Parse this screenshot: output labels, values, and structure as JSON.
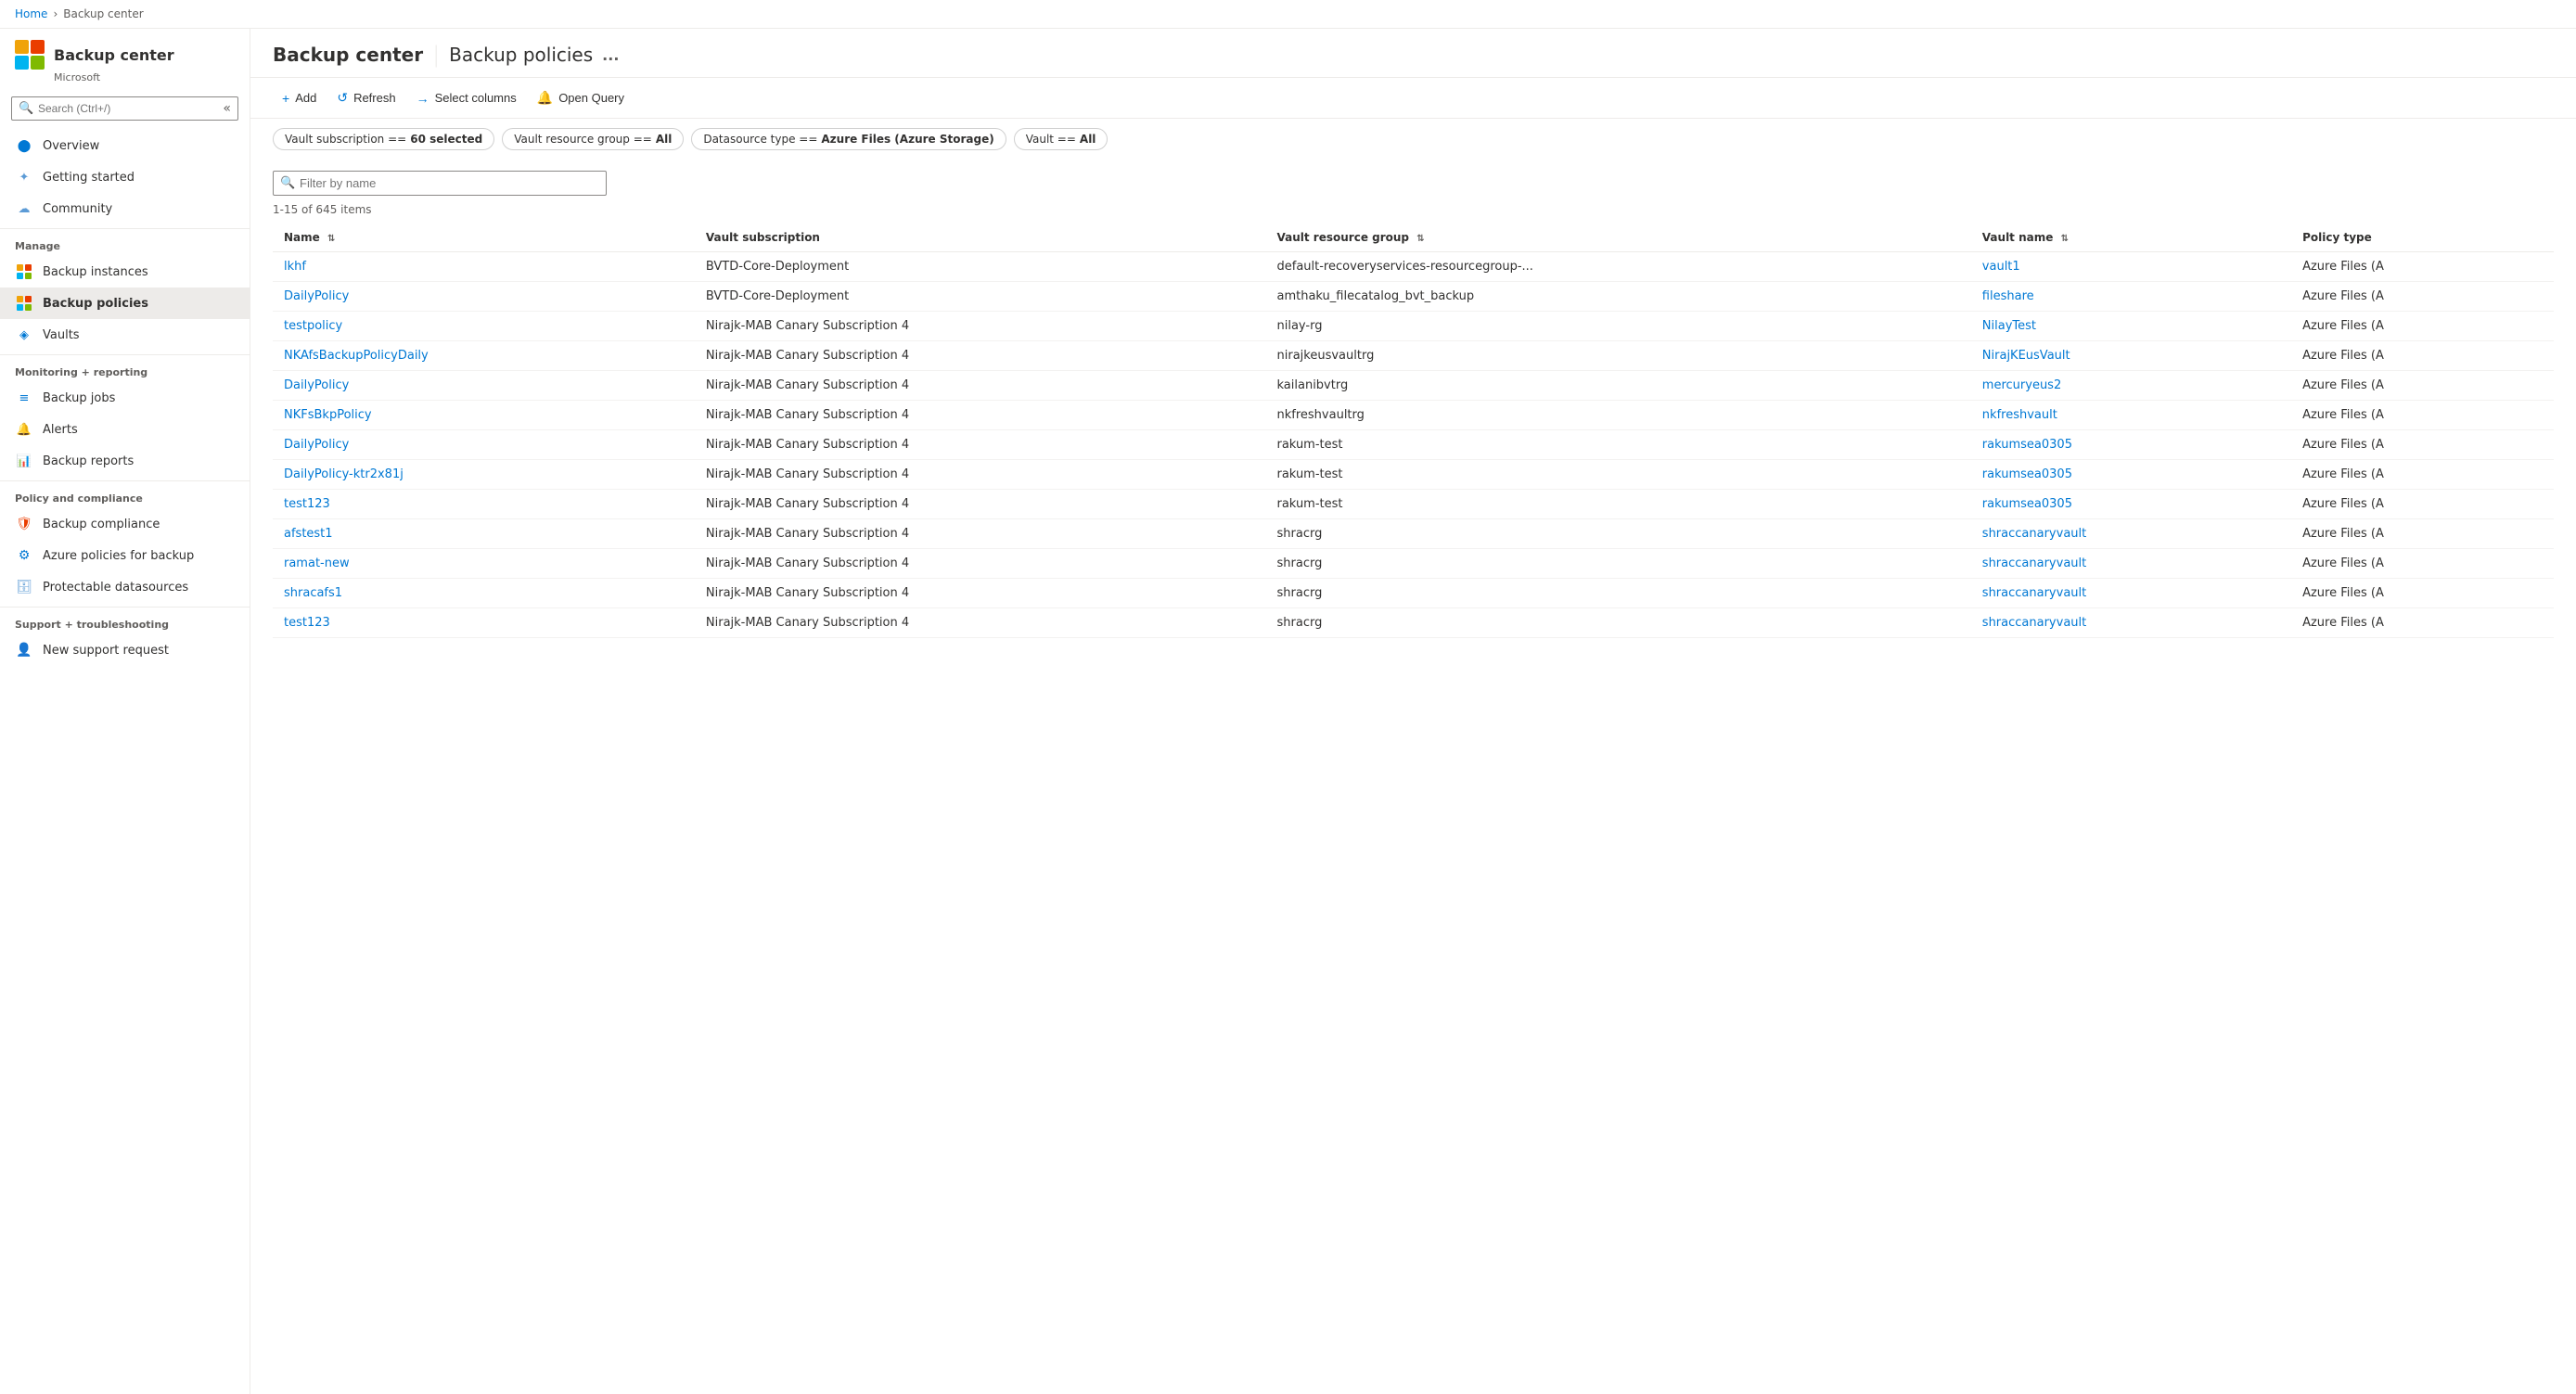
{
  "breadcrumb": {
    "home": "Home",
    "current": "Backup center"
  },
  "sidebar": {
    "logo_alt": "Backup center logo",
    "title": "Backup center",
    "subtitle": "Microsoft",
    "search_placeholder": "Search (Ctrl+/)",
    "collapse_title": "Collapse",
    "nav_items": [
      {
        "id": "overview",
        "label": "Overview",
        "icon": "circle"
      },
      {
        "id": "getting-started",
        "label": "Getting started",
        "icon": "spark"
      },
      {
        "id": "community",
        "label": "Community",
        "icon": "people"
      }
    ],
    "sections": [
      {
        "title": "Manage",
        "items": [
          {
            "id": "backup-instances",
            "label": "Backup instances",
            "icon": "grid"
          },
          {
            "id": "backup-policies",
            "label": "Backup policies",
            "icon": "grid-yellow",
            "active": true
          },
          {
            "id": "vaults",
            "label": "Vaults",
            "icon": "cube"
          }
        ]
      },
      {
        "title": "Monitoring + reporting",
        "items": [
          {
            "id": "backup-jobs",
            "label": "Backup jobs",
            "icon": "list"
          },
          {
            "id": "alerts",
            "label": "Alerts",
            "icon": "bell-green"
          },
          {
            "id": "backup-reports",
            "label": "Backup reports",
            "icon": "chart"
          }
        ]
      },
      {
        "title": "Policy and compliance",
        "items": [
          {
            "id": "backup-compliance",
            "label": "Backup compliance",
            "icon": "shield-orange"
          },
          {
            "id": "azure-policies",
            "label": "Azure policies for backup",
            "icon": "gear-blue"
          },
          {
            "id": "protectable-datasources",
            "label": "Protectable datasources",
            "icon": "db-blue"
          }
        ]
      },
      {
        "title": "Support + troubleshooting",
        "items": [
          {
            "id": "new-support",
            "label": "New support request",
            "icon": "person"
          }
        ]
      }
    ]
  },
  "header": {
    "title": "Backup center",
    "separator": "|",
    "page": "Backup policies",
    "more_label": "..."
  },
  "toolbar": {
    "add_label": "Add",
    "refresh_label": "Refresh",
    "select_columns_label": "Select columns",
    "open_query_label": "Open Query"
  },
  "filters": [
    {
      "key": "Vault subscription",
      "op": "==",
      "value": "60 selected"
    },
    {
      "key": "Vault resource group",
      "op": "==",
      "value": "All"
    },
    {
      "key": "Datasource type",
      "op": "==",
      "value": "Azure Files (Azure Storage)"
    },
    {
      "key": "Vault",
      "op": "==",
      "value": "All"
    }
  ],
  "filter_input": {
    "placeholder": "Filter by name"
  },
  "items_count": "1-15 of 645 items",
  "table": {
    "columns": [
      {
        "id": "name",
        "label": "Name",
        "sortable": true
      },
      {
        "id": "vault_subscription",
        "label": "Vault subscription",
        "sortable": false
      },
      {
        "id": "vault_resource_group",
        "label": "Vault resource group",
        "sortable": true
      },
      {
        "id": "vault_name",
        "label": "Vault name",
        "sortable": true
      },
      {
        "id": "policy_type",
        "label": "Policy type",
        "sortable": false
      }
    ],
    "rows": [
      {
        "name": "lkhf",
        "vault_subscription": "BVTD-Core-Deployment",
        "vault_resource_group": "default-recoveryservices-resourcegroup-...",
        "vault_name": "vault1",
        "policy_type": "Azure Files (A"
      },
      {
        "name": "DailyPolicy",
        "vault_subscription": "BVTD-Core-Deployment",
        "vault_resource_group": "amthaku_filecatalog_bvt_backup",
        "vault_name": "fileshare",
        "policy_type": "Azure Files (A"
      },
      {
        "name": "testpolicy",
        "vault_subscription": "Nirajk-MAB Canary Subscription 4",
        "vault_resource_group": "nilay-rg",
        "vault_name": "NilayTest",
        "policy_type": "Azure Files (A"
      },
      {
        "name": "NKAfsBackupPolicyDaily",
        "vault_subscription": "Nirajk-MAB Canary Subscription 4",
        "vault_resource_group": "nirajkeusvaultrg",
        "vault_name": "NirajKEusVault",
        "policy_type": "Azure Files (A"
      },
      {
        "name": "DailyPolicy",
        "vault_subscription": "Nirajk-MAB Canary Subscription 4",
        "vault_resource_group": "kailanibvtrg",
        "vault_name": "mercuryeus2",
        "policy_type": "Azure Files (A"
      },
      {
        "name": "NKFsBkpPolicy",
        "vault_subscription": "Nirajk-MAB Canary Subscription 4",
        "vault_resource_group": "nkfreshvaultrg",
        "vault_name": "nkfreshvault",
        "policy_type": "Azure Files (A"
      },
      {
        "name": "DailyPolicy",
        "vault_subscription": "Nirajk-MAB Canary Subscription 4",
        "vault_resource_group": "rakum-test",
        "vault_name": "rakumsea0305",
        "policy_type": "Azure Files (A"
      },
      {
        "name": "DailyPolicy-ktr2x81j",
        "vault_subscription": "Nirajk-MAB Canary Subscription 4",
        "vault_resource_group": "rakum-test",
        "vault_name": "rakumsea0305",
        "policy_type": "Azure Files (A"
      },
      {
        "name": "test123",
        "vault_subscription": "Nirajk-MAB Canary Subscription 4",
        "vault_resource_group": "rakum-test",
        "vault_name": "rakumsea0305",
        "policy_type": "Azure Files (A"
      },
      {
        "name": "afstest1",
        "vault_subscription": "Nirajk-MAB Canary Subscription 4",
        "vault_resource_group": "shracrg",
        "vault_name": "shraccanaryvault",
        "policy_type": "Azure Files (A"
      },
      {
        "name": "ramat-new",
        "vault_subscription": "Nirajk-MAB Canary Subscription 4",
        "vault_resource_group": "shracrg",
        "vault_name": "shraccanaryvault",
        "policy_type": "Azure Files (A"
      },
      {
        "name": "shracafs1",
        "vault_subscription": "Nirajk-MAB Canary Subscription 4",
        "vault_resource_group": "shracrg",
        "vault_name": "shraccanaryvault",
        "policy_type": "Azure Files (A"
      },
      {
        "name": "test123",
        "vault_subscription": "Nirajk-MAB Canary Subscription 4",
        "vault_resource_group": "shracrg",
        "vault_name": "shraccanaryvault",
        "policy_type": "Azure Files (A"
      }
    ]
  }
}
